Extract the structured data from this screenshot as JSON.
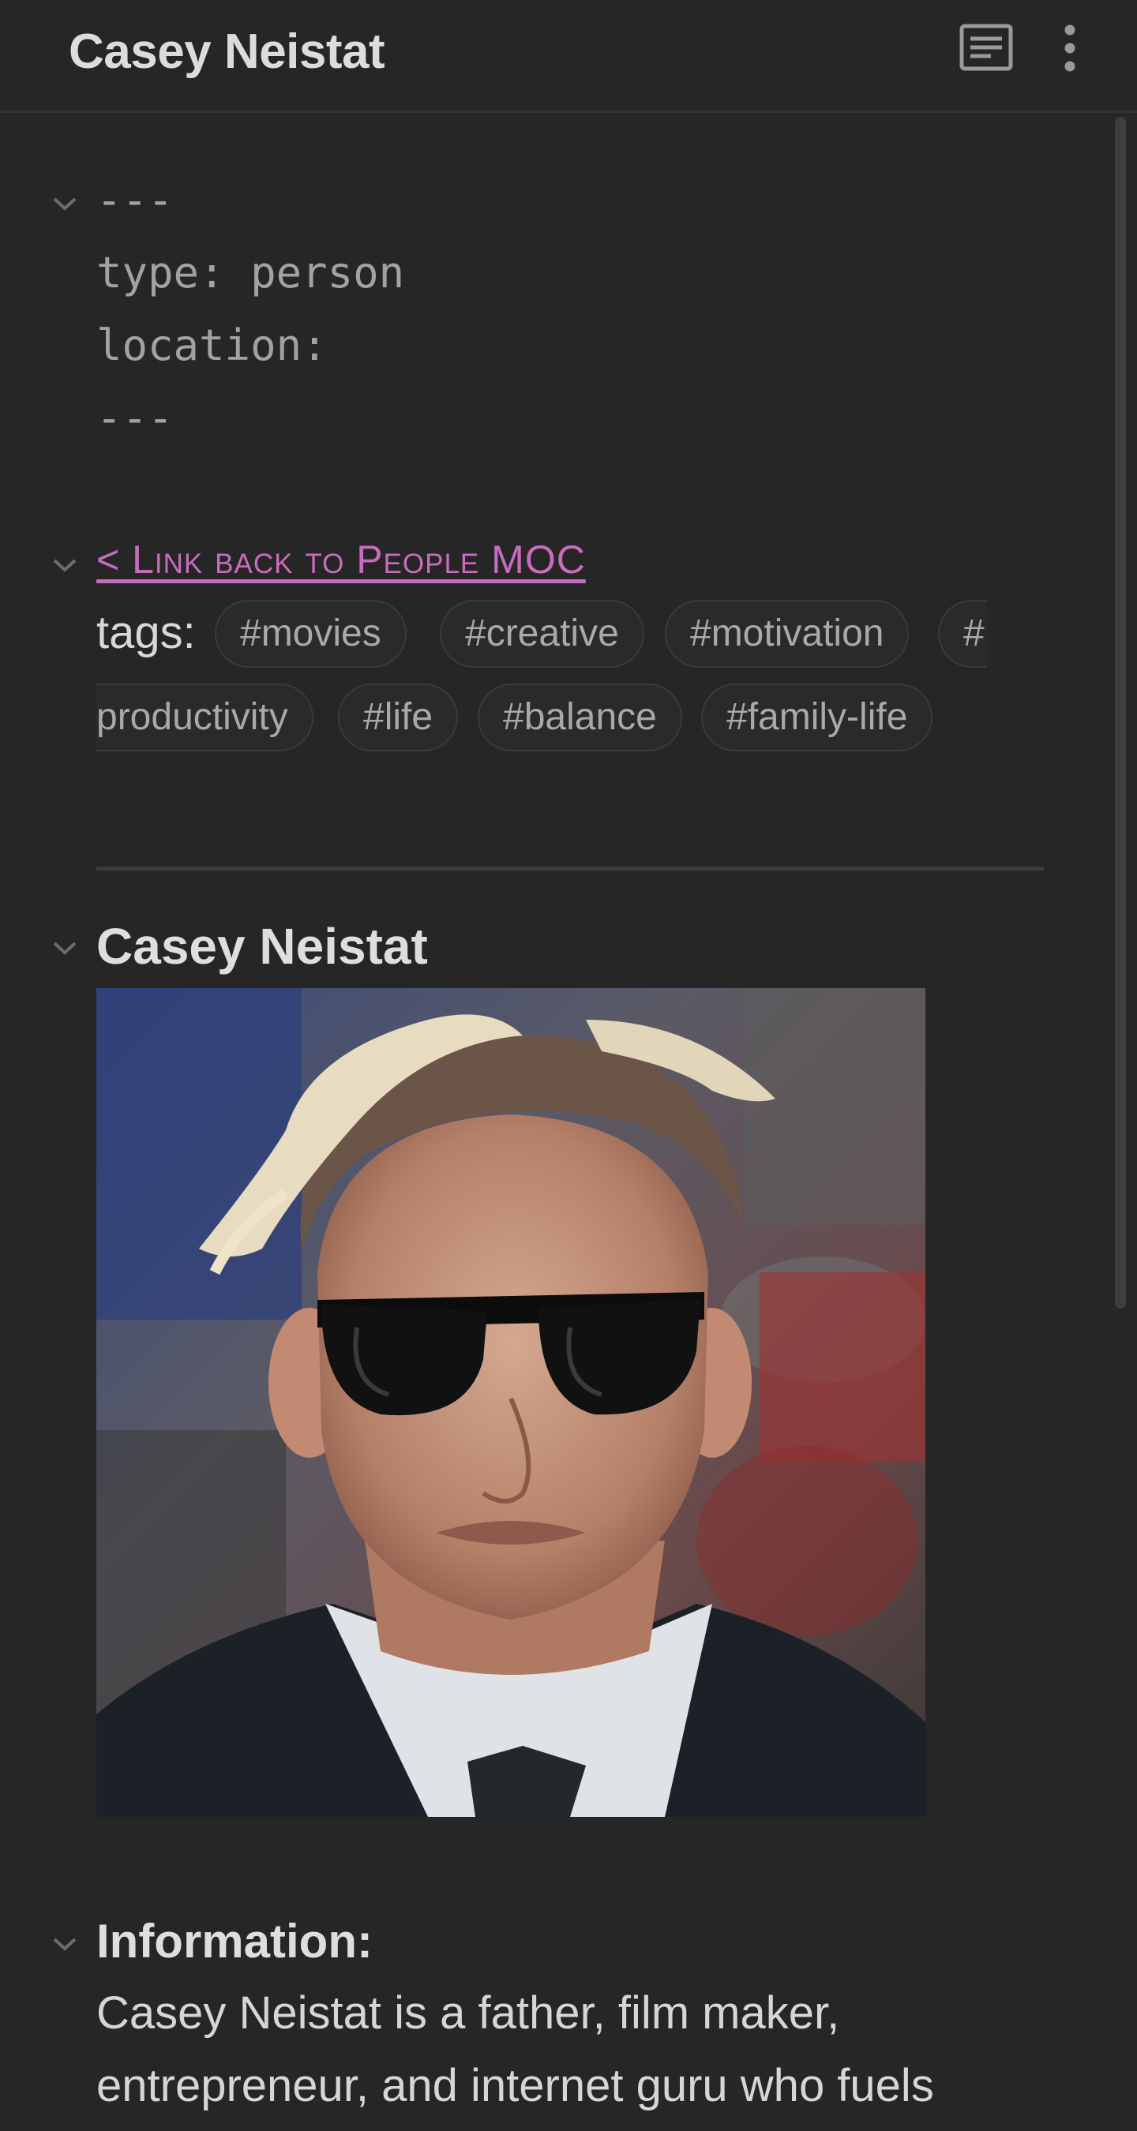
{
  "header": {
    "title": "Casey Neistat",
    "icons": [
      "reading-view-icon",
      "more-options-icon"
    ]
  },
  "frontmatter": {
    "open": "---",
    "line1": "type: person",
    "line2": "location:",
    "close": "---"
  },
  "backlink": {
    "text": "< Link back to People MOC"
  },
  "tags": {
    "label": "tags:",
    "items": [
      "#movies",
      "#creative",
      "#motivation",
      "#",
      "productivity",
      "#life",
      "#balance",
      "#family-life"
    ]
  },
  "sections": {
    "heading": "Casey Neistat",
    "info_heading": "Information:",
    "info_text": "Casey Neistat is a father, film maker, entrepreneur, and internet guru who fuels"
  },
  "colors": {
    "background": "#262626",
    "link": "#c86cbd",
    "tag_text": "#a9a9a9"
  }
}
